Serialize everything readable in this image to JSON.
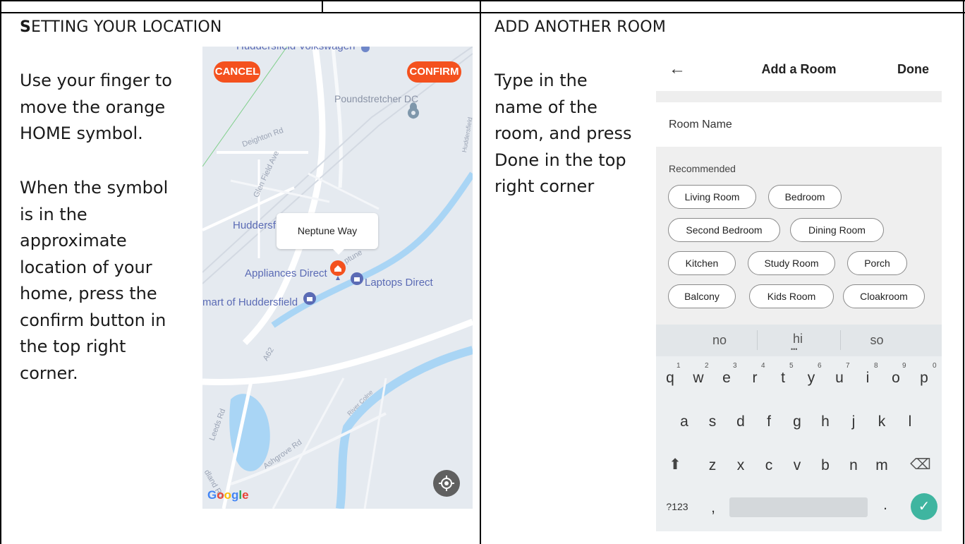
{
  "left": {
    "heading_first": "S",
    "heading_rest": "ETTING YOUR LOCATION",
    "p1_lines": [
      "Use your finger to",
      "move the orange",
      "HOME symbol."
    ],
    "p2_lines": [
      "When the symbol",
      "is in the",
      "approximate",
      "location of your",
      "home, press the",
      "confirm button in",
      "the top right",
      "corner."
    ]
  },
  "map": {
    "cancel": "CANCEL",
    "confirm": "CONFIRM",
    "labels": {
      "top_cut": "Huddersfield Volkswagen",
      "poundstretcher": "Poundstretcher DC",
      "huddersf": "Huddersf",
      "appliances": "Appliances Direct",
      "laptops": "Laptops Direct",
      "smart": "mart of Huddersfield"
    },
    "streets": {
      "deighton": "Deighton Rd",
      "glen": "Glen Field Ave",
      "neptune": "ptune",
      "a62": "A62",
      "leeds": "Leeds Rd",
      "ashgrove": "Ashgrove Rd",
      "river": "River Colne",
      "dland": "dland Rd",
      "hudd": "Huddersfield"
    },
    "tooltip": "Neptune Way",
    "google": [
      "G",
      "o",
      "o",
      "g",
      "l",
      "e"
    ],
    "google_colors": [
      "#4285F4",
      "#EA4335",
      "#FBBC05",
      "#4285F4",
      "#34A853",
      "#EA4335"
    ],
    "icons": [
      "pin-icon",
      "home-pin-icon",
      "shopping-bag-icon",
      "my-location-icon"
    ]
  },
  "right": {
    "heading": "ADD ANOTHER ROOM",
    "p_lines": [
      "Type in the",
      "name of the",
      "room, and press",
      "Done in the top",
      "right corner"
    ]
  },
  "phone": {
    "back_glyph": "←",
    "title": "Add a Room",
    "done": "Done",
    "room_name_placeholder": "Room Name",
    "recommended": "Recommended",
    "chips": [
      "Living Room",
      "Bedroom",
      "Second Bedroom",
      "Dining Room",
      "Kitchen",
      "Study Room",
      "Porch",
      "Balcony",
      "Kids Room",
      "Cloakroom"
    ],
    "suggestions": [
      "no",
      "hi",
      "so"
    ],
    "suggestion_dots": "•••",
    "row1": [
      "q",
      "w",
      "e",
      "r",
      "t",
      "y",
      "u",
      "i",
      "o",
      "p"
    ],
    "row1_hints": [
      "1",
      "2",
      "3",
      "4",
      "5",
      "6",
      "7",
      "8",
      "9",
      "0"
    ],
    "row2": [
      "a",
      "s",
      "d",
      "f",
      "g",
      "h",
      "j",
      "k",
      "l"
    ],
    "row3": [
      "z",
      "x",
      "c",
      "v",
      "b",
      "n",
      "m"
    ],
    "symbols_key": "?123",
    "comma": ",",
    "period": ".",
    "shift_glyph": "⬆",
    "backspace_glyph": "⌫",
    "check_glyph": "✓",
    "accent_color": "#3fb5a0"
  }
}
